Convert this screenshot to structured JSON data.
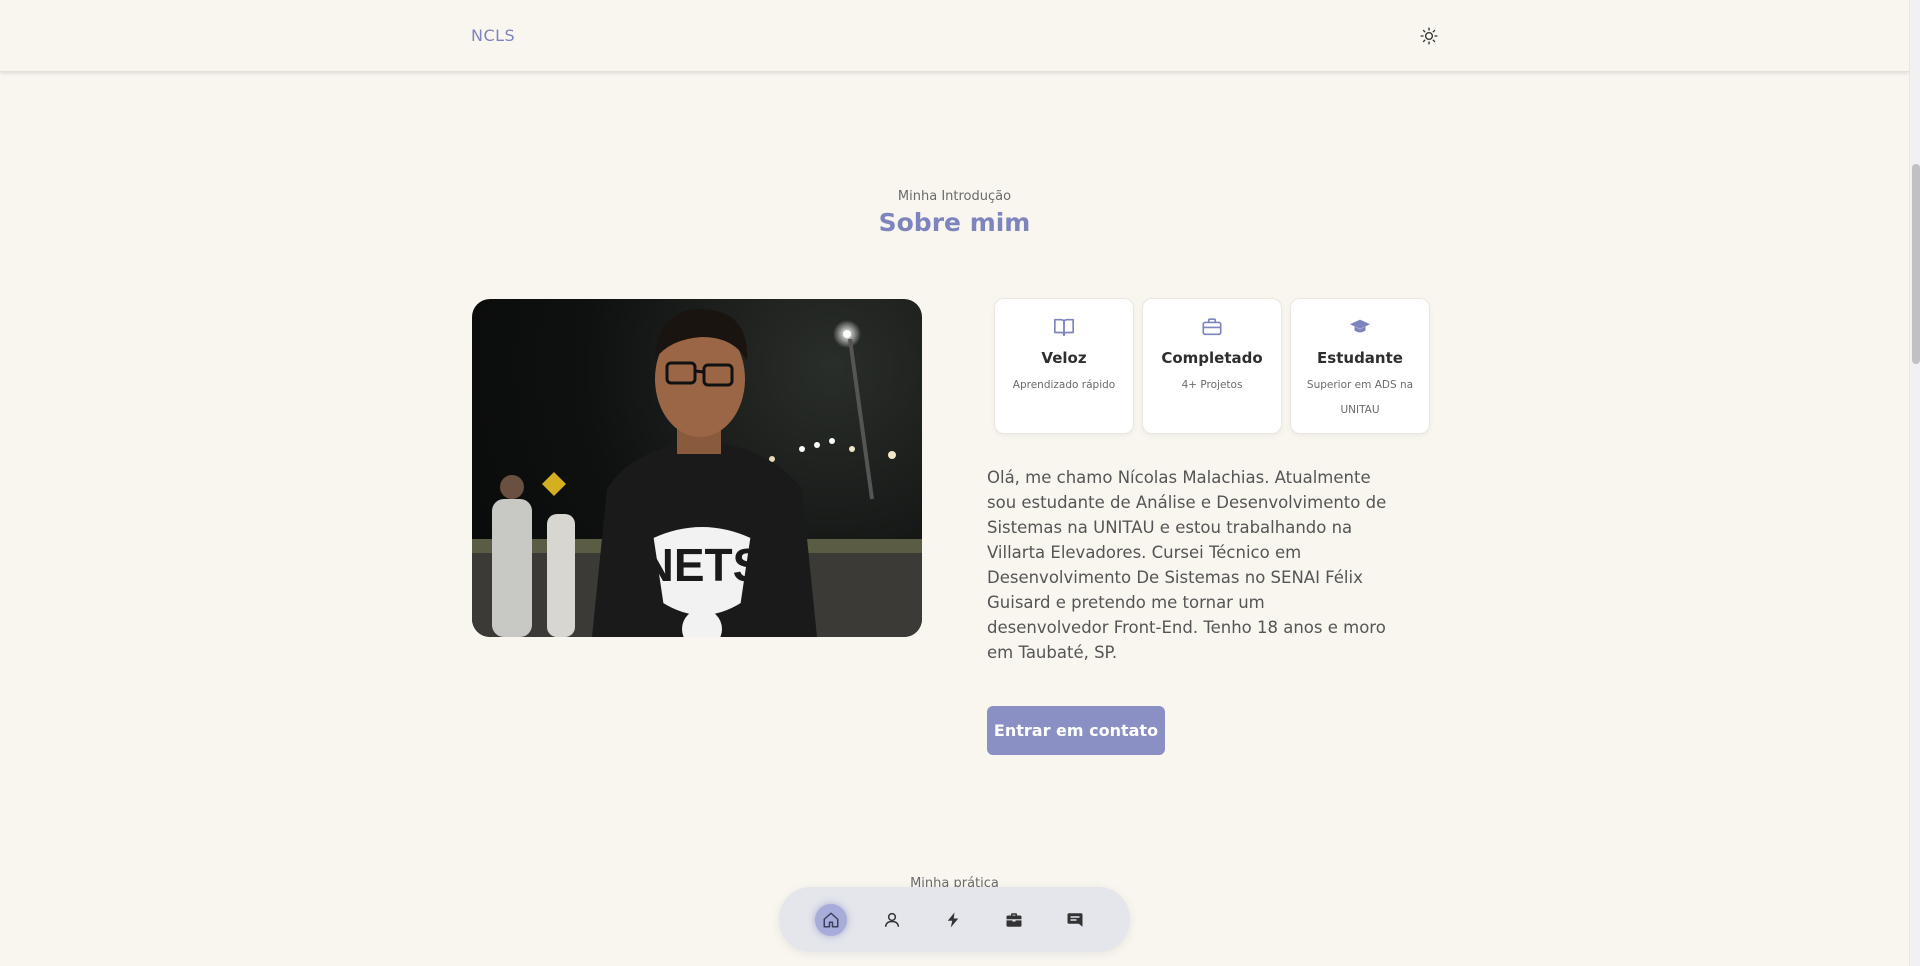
{
  "header": {
    "logo": "NCLS",
    "theme_toggle_icon": "sun-icon"
  },
  "about": {
    "subtitle": "Minha Introdução",
    "title": "Sobre mim",
    "cards": [
      {
        "icon": "book-icon",
        "title": "Veloz",
        "subtitle": "Aprendizado rápido"
      },
      {
        "icon": "briefcase-icon",
        "title": "Completado",
        "subtitle": "4+ Projetos"
      },
      {
        "icon": "graduation-cap-icon",
        "title": "Estudante",
        "subtitle": "Superior em ADS na UNITAU"
      }
    ],
    "description": "Olá, me chamo Nícolas Malachias. Atualmente sou estudante de Análise e Desenvolvimento de Sistemas na UNITAU e estou trabalhando na Villarta Elevadores. Cursei Técnico em Desenvolvimento De Sistemas no SENAI Félix Guisard e pretendo me tornar um desenvolvedor Front-End. Tenho 18 anos e moro em Taubaté, SP.",
    "cta_label": "Entrar em contato",
    "photo_shirt_text": "NETS"
  },
  "next_section": {
    "subtitle": "Minha prática"
  },
  "bottom_nav": {
    "items": [
      {
        "icon": "home-icon",
        "active": true
      },
      {
        "icon": "user-icon",
        "active": false
      },
      {
        "icon": "bolt-icon",
        "active": false
      },
      {
        "icon": "briefcase-icon",
        "active": false
      },
      {
        "icon": "message-icon",
        "active": false
      }
    ]
  },
  "colors": {
    "accent": "#7e84bd",
    "button": "#8b90c4",
    "background": "#f9f6f0"
  }
}
